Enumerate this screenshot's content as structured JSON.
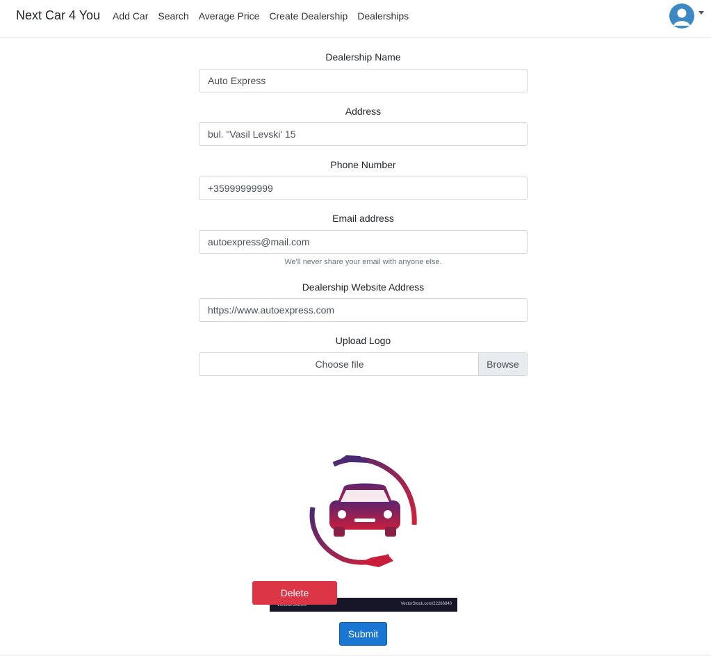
{
  "navbar": {
    "brand": "Next Car 4 You",
    "links": [
      "Add Car",
      "Search",
      "Average Price",
      "Create Dealership",
      "Dealerships"
    ]
  },
  "form": {
    "name_label": "Dealership Name",
    "name_value": "Auto Express",
    "address_label": "Address",
    "address_value": "bul. \"Vasil Levski' 15",
    "phone_label": "Phone Number",
    "phone_value": "+35999999999",
    "email_label": "Email address",
    "email_value": "autoexpress@mail.com",
    "email_help": "We'll never share your email with anyone else.",
    "website_label": "Dealership Website Address",
    "website_value": "https://www.autoexpress.com",
    "logo_label": "Upload Logo",
    "choose_file": "Choose file",
    "browse": "Browse"
  },
  "logo_strip": {
    "left_text": "VectorStock",
    "right_text": "VectorStock.com/22266840"
  },
  "buttons": {
    "delete": "Delete",
    "submit": "Submit"
  },
  "colors": {
    "delete": "#dc3545",
    "submit": "#1976d2",
    "avatar": "#3b88c3"
  }
}
